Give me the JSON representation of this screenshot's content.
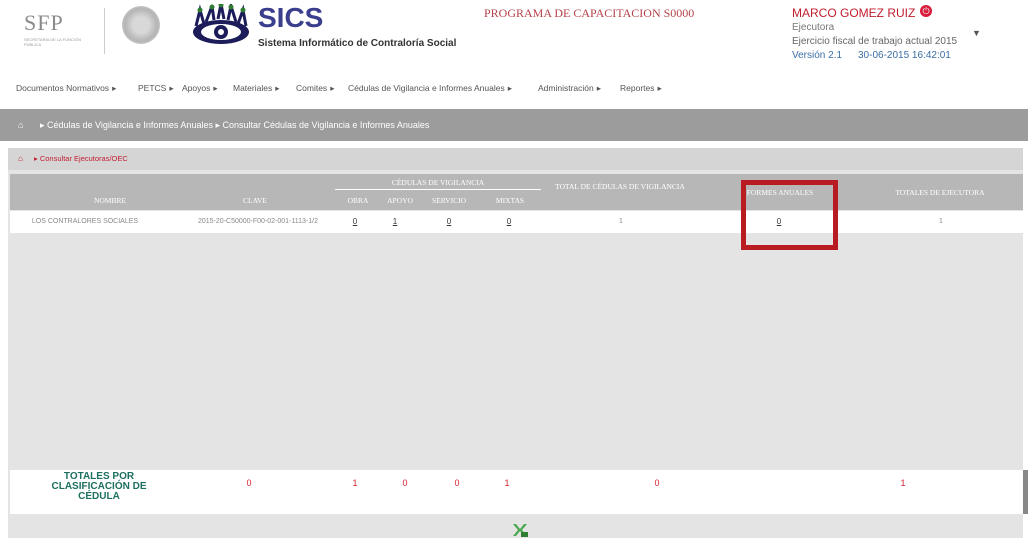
{
  "header": {
    "sfp_logo": "SFP",
    "sfp_sub": "SECRETARÍA DE LA FUNCIÓN PÚBLICA",
    "app_title": "SICS",
    "app_subtitle": "Sistema Informático de Contraloría Social",
    "programa": "PROGRAMA DE CAPACITACION S0000",
    "user_name": "MARCO GOMEZ RUIZ",
    "user_role": "Ejecutora",
    "ejercicio": "Ejercicio fiscal de trabajo actual 2015",
    "version": "Versión 2.1",
    "fecha": "30-06-2015 16:42:01",
    "caret": "▼",
    "power_icon": "⏻"
  },
  "menu": [
    "Documentos Normativos",
    "PETCS",
    "Apoyos",
    "Materiales",
    "Comites",
    "Cédulas de Vigilancia e Informes Anuales",
    "Administración",
    "Reportes"
  ],
  "breadcrumb_top": {
    "home_icon": "⌂",
    "text": "▸ Cédulas de Vigilancia e Informes Anuales ▸ Consultar Cédulas de Vigilancia e Informes Anuales"
  },
  "breadcrumb_sub": {
    "home_icon": "⌂",
    "text": "▸ Consultar Ejecutoras/OEC"
  },
  "table": {
    "headers": {
      "nombre": "NOMBRE",
      "clave": "CLAVE",
      "cedulas_group": "CÉDULAS DE VIGILANCIA",
      "obra": "OBRA",
      "apoyo": "APOYO",
      "servicio": "SERVICIO",
      "mixtas": "MIXTAS",
      "total_cedulas": "TOTAL DE CÉDULAS DE VIGILANCIA",
      "informes": "FORMES ANUALES",
      "totales_ejecutora": "TOTALES DE EJECUTORA"
    },
    "row": {
      "nombre": "LOS CONTRALORES SOCIALES",
      "clave": "2015-20-C50000-F00-02-001-1113-1/2",
      "obra": "0",
      "apoyo": "1",
      "servicio": "0",
      "mixtas": "0",
      "total_cedulas": "1",
      "informes": "0",
      "totales_ejecutora": "1"
    }
  },
  "totals": {
    "label": "TOTALES POR CLASIFICACIÓN DE CÉDULA",
    "clave": "0",
    "obra": "1",
    "apoyo": "0",
    "servicio": "0",
    "mixtas": "1",
    "total_cedulas": "0",
    "totales_ejecutora": "1"
  },
  "colors": {
    "accent_red": "#b81b22",
    "header_gray": "#b7b7b7",
    "breadcrumb_gray": "#9c9c9c",
    "totals_green": "#1d6f5f"
  },
  "icons": {
    "export": "excel-export-icon"
  }
}
